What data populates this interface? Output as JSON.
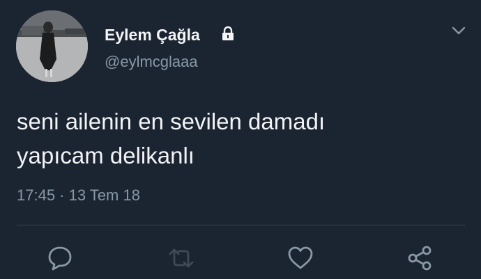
{
  "author": {
    "display_name": "Eylem Çağla",
    "handle": "@eylmcglaaa",
    "protected_icon": "lock-icon"
  },
  "tweet": {
    "text_lines": [
      "seni ailenin en sevilen damadı",
      "yapıcam delikanlı"
    ],
    "timestamp": "17:45 · 13 Tem 18"
  },
  "actions": [
    {
      "name": "reply",
      "icon": "speech-bubble-icon"
    },
    {
      "name": "retweet",
      "icon": "retweet-arrows-icon"
    },
    {
      "name": "like",
      "icon": "heart-icon"
    },
    {
      "name": "share",
      "icon": "share-nodes-icon"
    }
  ],
  "menu_icon": "chevron-down-icon",
  "colors": {
    "background": "#1b2431",
    "primary_text": "#f3f5f7",
    "secondary_text": "#8899a6",
    "divider": "#38444d",
    "icon": "#8899a6"
  }
}
